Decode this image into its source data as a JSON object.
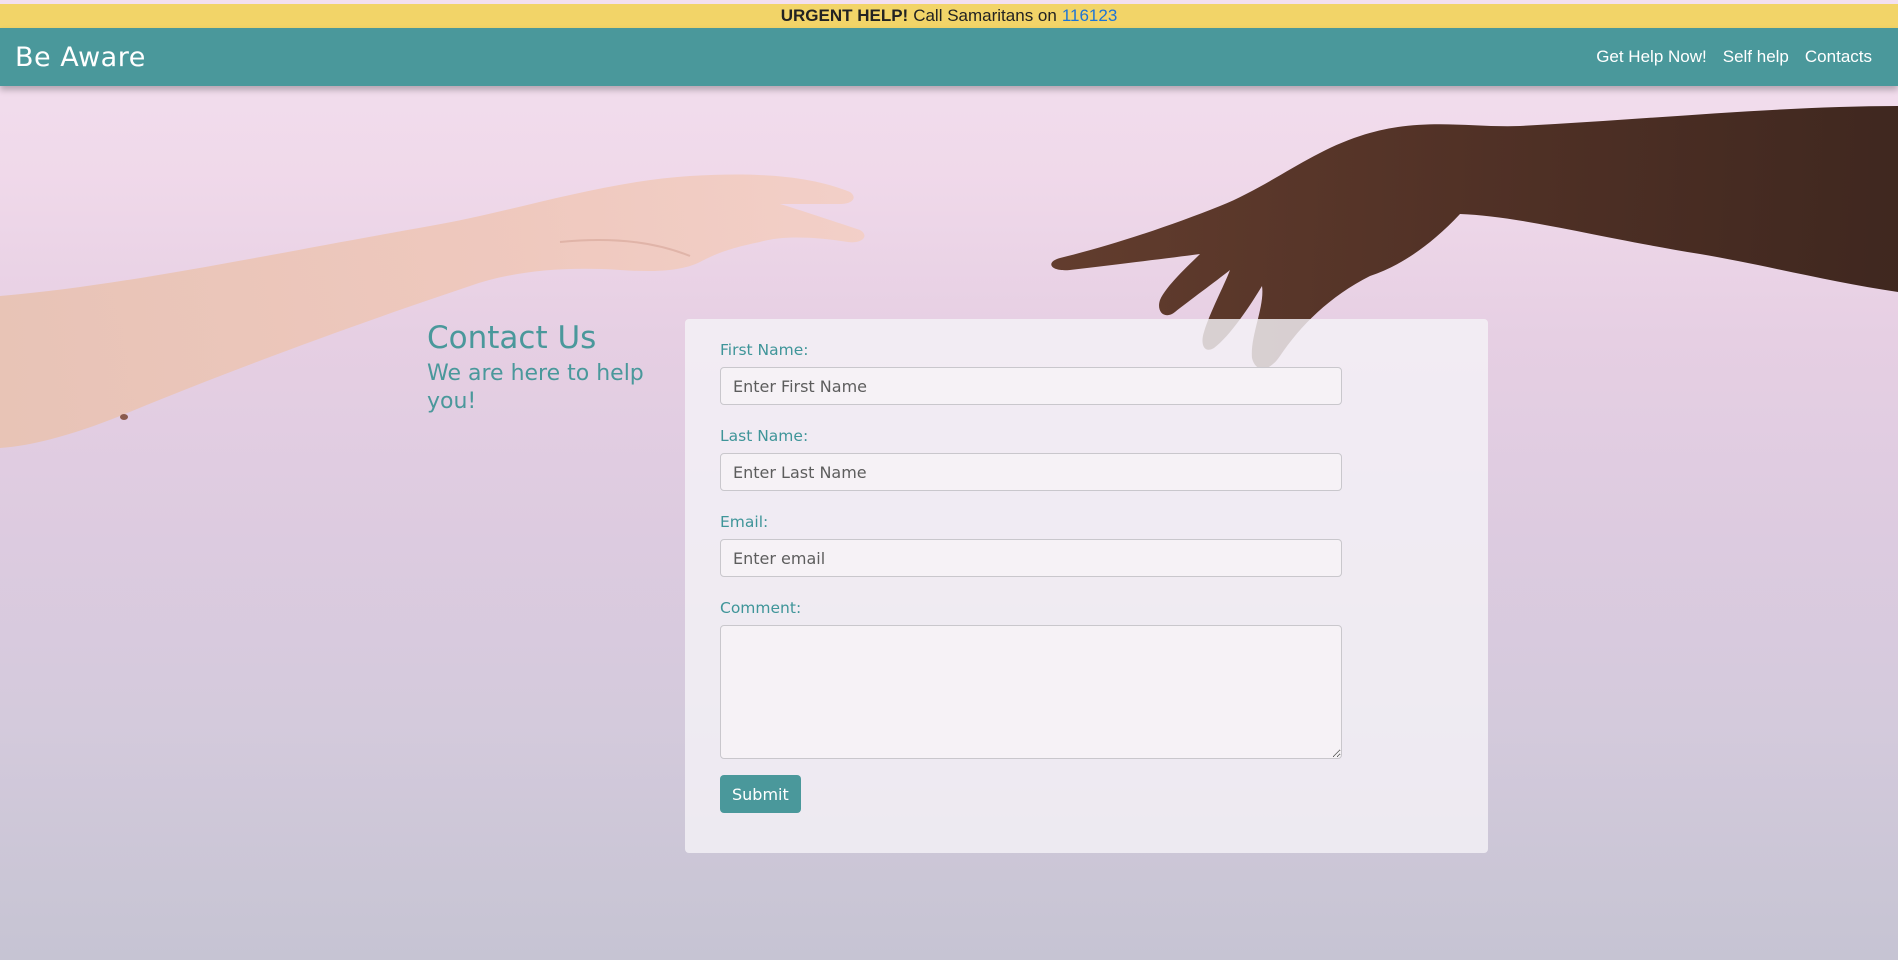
{
  "banner": {
    "urgent_label": "URGENT HELP!",
    "message": "Call Samaritans on",
    "phone": "116123"
  },
  "navbar": {
    "brand": "Be Aware",
    "links": [
      "Get Help Now!",
      "Self help",
      "Contacts"
    ]
  },
  "contact": {
    "title": "Contact Us",
    "subtitle": "We are here to help you!"
  },
  "form": {
    "first_name_label": "First Name:",
    "first_name_placeholder": "Enter First Name",
    "last_name_label": "Last Name:",
    "last_name_placeholder": "Enter Last Name",
    "email_label": "Email:",
    "email_placeholder": "Enter email",
    "comment_label": "Comment:",
    "submit_label": "Submit"
  },
  "colors": {
    "banner": "#f2d468",
    "accent": "#4a989b",
    "phone_link": "#1d74d6"
  }
}
